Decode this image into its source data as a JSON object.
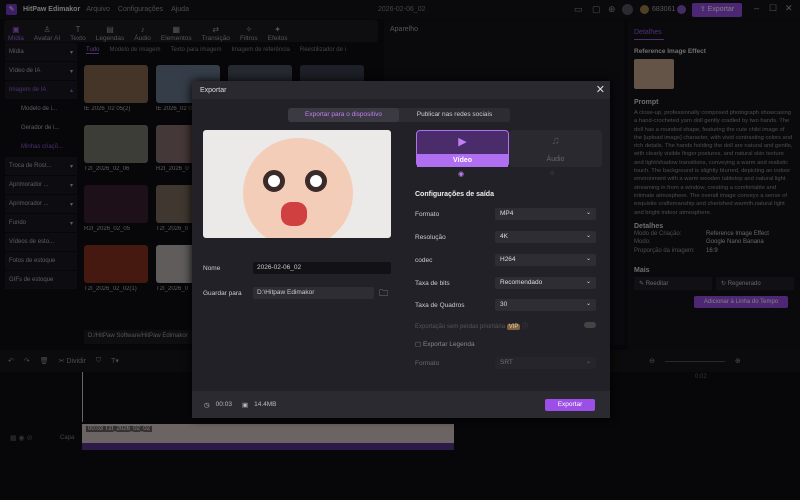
{
  "titlebar": {
    "app": "HitPaw Edimakor",
    "menus": [
      "Arquivo",
      "Configurações",
      "Ajuda"
    ],
    "project": "2026-02-06_02",
    "credits": "683061",
    "export": "Exportar"
  },
  "toolbar": [
    "Mídia",
    "Avatar AI",
    "Texto",
    "Legendas",
    "Áudio",
    "Elementos",
    "Transição",
    "Filtros",
    "Efeitos"
  ],
  "sidebar": [
    {
      "label": "Mídia"
    },
    {
      "label": "Vídeo de IA"
    },
    {
      "label": "Imagem de IA"
    },
    {
      "label": "Modelo de i..."
    },
    {
      "label": "Gerador de i..."
    },
    {
      "label": "Minhas criaçõ..."
    },
    {
      "label": "Troca de Rost..."
    },
    {
      "label": "Aprimorador ..."
    },
    {
      "label": "Aprimorador ..."
    },
    {
      "label": "Fundo"
    },
    {
      "label": "Vídeos de esto..."
    },
    {
      "label": "Fotos de estoque"
    },
    {
      "label": "GIFs de estoque"
    }
  ],
  "media_tabs": [
    "Tudo",
    "Modelo de imagem",
    "Texto para imagem",
    "Imagem de referência",
    "Reestilizador de i"
  ],
  "media": [
    "IE 2026_02 05(2)",
    "IE 2026_02 0",
    "T2I_2026_02_06",
    "R2I_2026_0",
    "R2I_2026_02_05",
    "T2I_2026_0",
    "T2I_2026_02_02(1)",
    "T2I_2026_0"
  ],
  "path": "D:/HitPaw Software/HitPaw Edimakor",
  "player": {
    "title": "Aparelho"
  },
  "details": {
    "tab": "Detalhes",
    "effect": "Reference Image Effect",
    "prompt_title": "Prompt",
    "prompt": "A close-up, professionally composed photograph showcasing a hand-crocheted yarn doll gently cradled by two hands. The doll has a rounded shape, featuring the cute chibi image of the [upload image] character, with vivid contrasting colors and rich details. The hands holding the doll are natural and gentle, with clearly visible finger postures, and natural skin texture and light/shadow transitions, conveying a warm and realistic touch. The background is slightly blurred, depicting an indoor environment with a warm wooden tabletop and natural light streaming in from a window, creating a comfortable and intimate atmosphere. The overall image conveys a sense of exquisite craftsmanship and cherished warmth,natural light and bright indoor atmosphere.",
    "details_title": "Detalhes",
    "rows": [
      [
        "Modo de Criação:",
        "Reference Image Effect"
      ],
      [
        "Modo:",
        "Google Nano Banana"
      ],
      [
        "Proporção da imagem:",
        "16:9"
      ]
    ],
    "more": "Mais",
    "reedit": "Reeditar",
    "regen": "Regenerado",
    "add": "Adicionar à Linha do Tempo"
  },
  "timeline": {
    "split": "Dividir",
    "ruler": "0:02",
    "track": "Capa",
    "clip": "00:03 T2I_2026_02_02"
  },
  "modal": {
    "title": "Exportar",
    "tabs": [
      "Exportar para o dispositivo",
      "Publicar nas redes sociais"
    ],
    "video": "Vídeo",
    "audio": "Áudio",
    "output_title": "Configurações de saída",
    "settings": [
      [
        "Formato",
        "MP4"
      ],
      [
        "Resolução",
        "4K"
      ],
      [
        "codec",
        "H264"
      ],
      [
        "Taxa de bits",
        "Recomendado"
      ],
      [
        "Taxa de Quadros",
        "30"
      ]
    ],
    "lossless": "Exportação sem perdas prioritária",
    "vip": "VIP",
    "subtitle": "Exportar Legenda",
    "sub_format": "Formato",
    "sub_value": "SRT",
    "name_label": "Nome",
    "name": "2026-02-06_02",
    "save_label": "Guardar para",
    "save": "D:\\Hitpaw Edimakor",
    "duration": "00:03",
    "size": "14.4MB",
    "export": "Exportar"
  },
  "colors": {
    "accent": "#9b4fe6"
  }
}
